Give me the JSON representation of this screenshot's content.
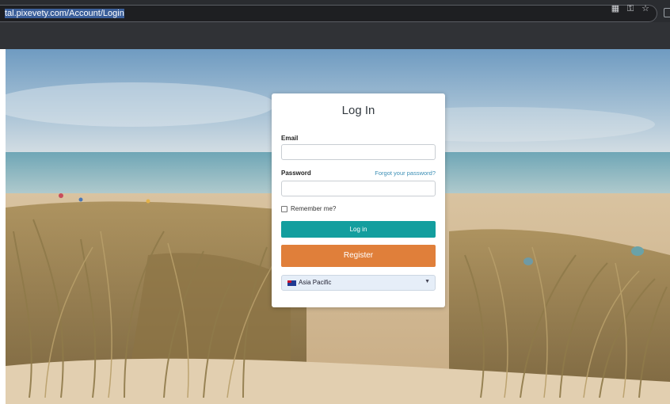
{
  "browser": {
    "url": "tal.pixevety.com/Account/Login",
    "icons": [
      "qr-code-icon",
      "key-icon",
      "star-icon"
    ]
  },
  "login": {
    "title": "Log In",
    "email_label": "Email",
    "email_value": "",
    "password_label": "Password",
    "password_value": "",
    "forgot_link": "Forgot your password?",
    "remember_label": "Remember me?",
    "remember_checked": false,
    "login_button": "Log in",
    "register_button": "Register",
    "region_selected": "Asia Pacific"
  },
  "colors": {
    "login_button": "#139e9e",
    "register_button": "#e07f3a",
    "link": "#3d8fb5"
  }
}
